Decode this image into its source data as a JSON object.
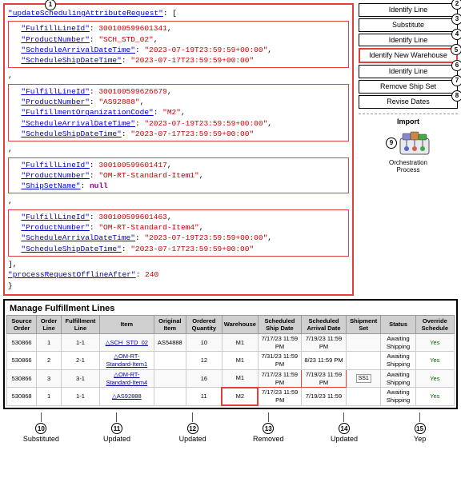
{
  "header": {
    "number": "1",
    "key": "updateSchedulingAttributeRequest",
    "colon": ":"
  },
  "callouts": [
    {
      "id": "2",
      "label": "Identify Line",
      "highlighted": false
    },
    {
      "id": "3",
      "label": "Substitute",
      "highlighted": false
    },
    {
      "id": "4",
      "label": "Identify Line",
      "highlighted": false
    },
    {
      "id": "5",
      "label": "Identify New Warehouse",
      "highlighted": true
    },
    {
      "id": "6",
      "label": "Identify Line",
      "highlighted": false
    },
    {
      "id": "7",
      "label": "Remove Ship Set",
      "highlighted": false
    },
    {
      "id": "8",
      "label": "Revise Dates",
      "highlighted": false
    },
    {
      "id": "9",
      "label": "Import",
      "orchestration": true
    }
  ],
  "blocks": [
    {
      "fields": [
        {
          "key": "FulfillLineId",
          "value": "300100599601341",
          "type": "number"
        },
        {
          "key": "ProductNumber",
          "value": "\"SCH_STD_02\"",
          "type": "string"
        },
        {
          "key": "ScheduleArrivalDateTime",
          "value": "\"2023-07-19T23:59:59+00:00\"",
          "type": "string"
        },
        {
          "key": "ScheduleShipDateTime",
          "value": "\"2023-07-17T23:59:59+00:00\"",
          "type": "string"
        }
      ]
    },
    {
      "fields": [
        {
          "key": "FulfillLineId",
          "value": "300100599626679",
          "type": "number"
        },
        {
          "key": "ProductNumber",
          "value": "\"AS92888\"",
          "type": "string"
        },
        {
          "key": "FulfillmentOrganizationCode",
          "value": "\"M2\"",
          "type": "string"
        },
        {
          "key": "ScheduleArrivalDateTime",
          "value": "\"2023-07-19T23:59:59+00:00\"",
          "type": "string"
        },
        {
          "key": "ScheduleShipDateTime",
          "value": "\"2023-07-17T23:59:59+00:00\"",
          "type": "string"
        }
      ]
    },
    {
      "fields": [
        {
          "key": "FulfillLineId",
          "value": "300100599601417",
          "type": "number"
        },
        {
          "key": "ProductNumber",
          "value": "\"OM-RT-Standard-Item1\"",
          "type": "string"
        },
        {
          "key": "ShipSetName",
          "value": "null",
          "type": "null"
        }
      ]
    },
    {
      "fields": [
        {
          "key": "FulfillLineId",
          "value": "300100599601463",
          "type": "number"
        },
        {
          "key": "ProductNumber",
          "value": "\"OM-RT-Standard-Item4\"",
          "type": "string"
        },
        {
          "key": "ScheduleArrivalDateTime",
          "value": "\"2023-07-19T23:59:59+00:00\"",
          "type": "string"
        },
        {
          "key": "ScheduleShipDateTime",
          "value": "\"2023-07-17T23:59:59+00:00\"",
          "type": "string"
        }
      ]
    }
  ],
  "footer_key": "processRequestOfflineAfter",
  "footer_value": "240",
  "section_title": "Manage Fulfillment Lines",
  "table": {
    "headers": [
      "Source Order",
      "Order Line",
      "Fulfillment Line",
      "Item",
      "Original Item",
      "Ordered Quantity",
      "Warehouse",
      "Scheduled Ship Date",
      "Scheduled Arrival Date",
      "Shipment Set",
      "Status",
      "Override Schedule"
    ],
    "rows": [
      {
        "source": "530866",
        "order_line": "1",
        "fulfillment_line": "1-1",
        "item": "SCH_STD_02",
        "orig_item": "AS54888",
        "qty": "10",
        "warehouse": "M1",
        "ship_date": "7/17/23 11:59 PM",
        "arrival_date": "7/19/23 11:59 PM",
        "shipset": "",
        "status": "Awaiting Shipping",
        "override": "Yes",
        "item_underline": true,
        "warehouse_highlight": false
      },
      {
        "source": "530866",
        "order_line": "2",
        "fulfillment_line": "2-1",
        "item": "OM-RT-Standard-Item1",
        "orig_item": "",
        "qty": "12",
        "warehouse": "M1",
        "ship_date": "7/31/23 11:59 PM",
        "arrival_date": "8/23 11:59 PM",
        "shipset": "",
        "status": "Awaiting Shipping",
        "override": "Yes",
        "item_underline": true,
        "warehouse_highlight": false
      },
      {
        "source": "530866",
        "order_line": "3",
        "fulfillment_line": "3-1",
        "item": "OM-RT-Standard-Item4",
        "orig_item": "",
        "qty": "16",
        "warehouse": "M1",
        "ship_date": "7/17/23 11:59 PM",
        "arrival_date": "7/19/23 11:59 PM",
        "shipset": "SS1",
        "status": "Awaiting Shipping",
        "override": "Yes",
        "item_underline": true,
        "warehouse_highlight": false,
        "date_highlight": true
      },
      {
        "source": "530868",
        "order_line": "1",
        "fulfillment_line": "1-1",
        "item": "AS92888",
        "orig_item": "",
        "qty": "11",
        "warehouse": "M2",
        "ship_date": "7/17/23 11:59 PM",
        "arrival_date": "7/19/23 11:59",
        "shipset": "",
        "status": "Awaiting Shipping",
        "override": "Yes",
        "item_underline": true,
        "warehouse_highlight": true
      }
    ]
  },
  "annotations": [
    {
      "id": "10",
      "label": "Substituted"
    },
    {
      "id": "11",
      "label": "Updated"
    },
    {
      "id": "12",
      "label": "Updated"
    },
    {
      "id": "13",
      "label": "Removed"
    },
    {
      "id": "14",
      "label": "Updated"
    },
    {
      "id": "15",
      "label": "Yep"
    }
  ],
  "orchestration_label": "Orchestration Process",
  "import_label": "Import"
}
